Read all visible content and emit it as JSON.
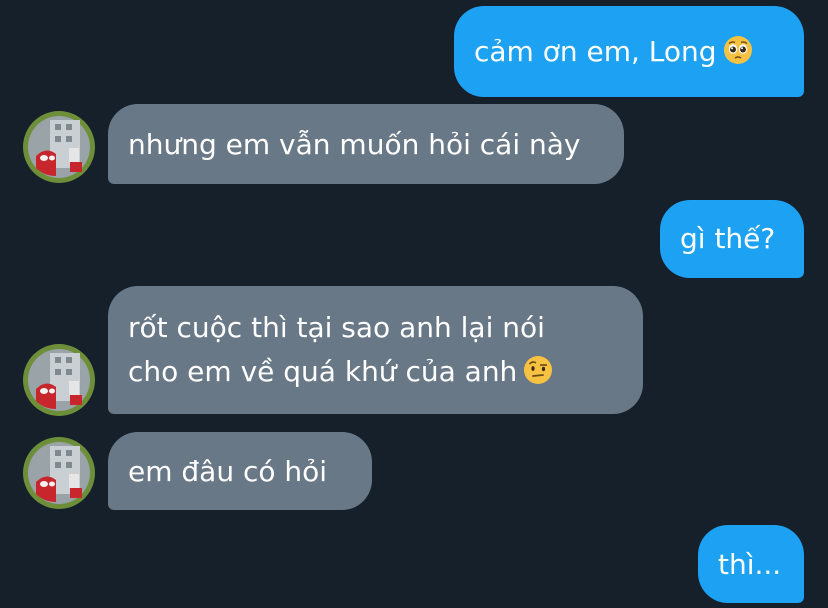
{
  "conversation": {
    "messages": [
      {
        "direction": "outgoing",
        "text": "cảm ơn em, Long",
        "emoji": "pleading-face-emoji"
      },
      {
        "direction": "incoming",
        "text": "nhưng em vẫn muốn hỏi cái này"
      },
      {
        "direction": "outgoing",
        "text": "gì thế?"
      },
      {
        "direction": "incoming",
        "lines": [
          "rốt cuộc thì tại sao anh lại nói",
          "cho em về quá khứ của anh"
        ],
        "emoji": "face-with-raised-eyebrow-emoji"
      },
      {
        "direction": "incoming",
        "text": "em đâu có hỏi"
      },
      {
        "direction": "outgoing",
        "text": "thì..."
      }
    ]
  },
  "colors": {
    "background": "#15202b",
    "outgoing_bubble": "#1da1f2",
    "incoming_bubble": "#697886",
    "text": "#ffffff"
  },
  "icons": {
    "avatar": "spiderman-avatar"
  }
}
